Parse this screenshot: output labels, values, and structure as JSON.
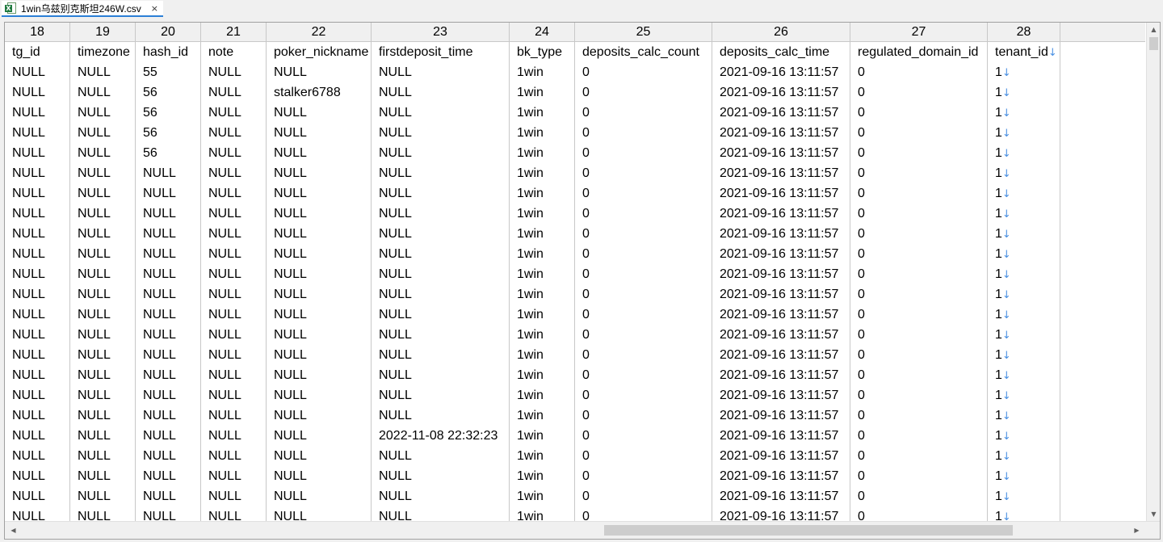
{
  "tab": {
    "title": "1win乌兹别克斯坦246W.csv",
    "close": "×",
    "icon": "excel-file-icon"
  },
  "columns": [
    {
      "number": "18",
      "name": "tg_id"
    },
    {
      "number": "19",
      "name": "timezone"
    },
    {
      "number": "20",
      "name": "hash_id"
    },
    {
      "number": "21",
      "name": "note"
    },
    {
      "number": "22",
      "name": "poker_nickname"
    },
    {
      "number": "23",
      "name": "firstdeposit_time"
    },
    {
      "number": "24",
      "name": "bk_type"
    },
    {
      "number": "25",
      "name": "deposits_calc_count"
    },
    {
      "number": "26",
      "name": "deposits_calc_time"
    },
    {
      "number": "27",
      "name": "regulated_domain_id"
    },
    {
      "number": "28",
      "name": "tenant_id"
    }
  ],
  "line_end_marker": "↓",
  "rows": [
    [
      "NULL",
      "NULL",
      "55",
      "NULL",
      "NULL",
      "NULL",
      "1win",
      "0",
      "2021-09-16 13:11:57",
      "0",
      "1"
    ],
    [
      "NULL",
      "NULL",
      "56",
      "NULL",
      "stalker6788",
      "NULL",
      "1win",
      "0",
      "2021-09-16 13:11:57",
      "0",
      "1"
    ],
    [
      "NULL",
      "NULL",
      "56",
      "NULL",
      "NULL",
      "NULL",
      "1win",
      "0",
      "2021-09-16 13:11:57",
      "0",
      "1"
    ],
    [
      "NULL",
      "NULL",
      "56",
      "NULL",
      "NULL",
      "NULL",
      "1win",
      "0",
      "2021-09-16 13:11:57",
      "0",
      "1"
    ],
    [
      "NULL",
      "NULL",
      "56",
      "NULL",
      "NULL",
      "NULL",
      "1win",
      "0",
      "2021-09-16 13:11:57",
      "0",
      "1"
    ],
    [
      "NULL",
      "NULL",
      "NULL",
      "NULL",
      "NULL",
      "NULL",
      "1win",
      "0",
      "2021-09-16 13:11:57",
      "0",
      "1"
    ],
    [
      "NULL",
      "NULL",
      "NULL",
      "NULL",
      "NULL",
      "NULL",
      "1win",
      "0",
      "2021-09-16 13:11:57",
      "0",
      "1"
    ],
    [
      "NULL",
      "NULL",
      "NULL",
      "NULL",
      "NULL",
      "NULL",
      "1win",
      "0",
      "2021-09-16 13:11:57",
      "0",
      "1"
    ],
    [
      "NULL",
      "NULL",
      "NULL",
      "NULL",
      "NULL",
      "NULL",
      "1win",
      "0",
      "2021-09-16 13:11:57",
      "0",
      "1"
    ],
    [
      "NULL",
      "NULL",
      "NULL",
      "NULL",
      "NULL",
      "NULL",
      "1win",
      "0",
      "2021-09-16 13:11:57",
      "0",
      "1"
    ],
    [
      "NULL",
      "NULL",
      "NULL",
      "NULL",
      "NULL",
      "NULL",
      "1win",
      "0",
      "2021-09-16 13:11:57",
      "0",
      "1"
    ],
    [
      "NULL",
      "NULL",
      "NULL",
      "NULL",
      "NULL",
      "NULL",
      "1win",
      "0",
      "2021-09-16 13:11:57",
      "0",
      "1"
    ],
    [
      "NULL",
      "NULL",
      "NULL",
      "NULL",
      "NULL",
      "NULL",
      "1win",
      "0",
      "2021-09-16 13:11:57",
      "0",
      "1"
    ],
    [
      "NULL",
      "NULL",
      "NULL",
      "NULL",
      "NULL",
      "NULL",
      "1win",
      "0",
      "2021-09-16 13:11:57",
      "0",
      "1"
    ],
    [
      "NULL",
      "NULL",
      "NULL",
      "NULL",
      "NULL",
      "NULL",
      "1win",
      "0",
      "2021-09-16 13:11:57",
      "0",
      "1"
    ],
    [
      "NULL",
      "NULL",
      "NULL",
      "NULL",
      "NULL",
      "NULL",
      "1win",
      "0",
      "2021-09-16 13:11:57",
      "0",
      "1"
    ],
    [
      "NULL",
      "NULL",
      "NULL",
      "NULL",
      "NULL",
      "NULL",
      "1win",
      "0",
      "2021-09-16 13:11:57",
      "0",
      "1"
    ],
    [
      "NULL",
      "NULL",
      "NULL",
      "NULL",
      "NULL",
      "NULL",
      "1win",
      "0",
      "2021-09-16 13:11:57",
      "0",
      "1"
    ],
    [
      "NULL",
      "NULL",
      "NULL",
      "NULL",
      "NULL",
      "2022-11-08 22:32:23",
      "1win",
      "0",
      "2021-09-16 13:11:57",
      "0",
      "1"
    ],
    [
      "NULL",
      "NULL",
      "NULL",
      "NULL",
      "NULL",
      "NULL",
      "1win",
      "0",
      "2021-09-16 13:11:57",
      "0",
      "1"
    ],
    [
      "NULL",
      "NULL",
      "NULL",
      "NULL",
      "NULL",
      "NULL",
      "1win",
      "0",
      "2021-09-16 13:11:57",
      "0",
      "1"
    ],
    [
      "NULL",
      "NULL",
      "NULL",
      "NULL",
      "NULL",
      "NULL",
      "1win",
      "0",
      "2021-09-16 13:11:57",
      "0",
      "1"
    ],
    [
      "NULL",
      "NULL",
      "NULL",
      "NULL",
      "NULL",
      "NULL",
      "1win",
      "0",
      "2021-09-16 13:11:57",
      "0",
      "1"
    ]
  ],
  "scrollbars": {
    "up": "▲",
    "down": "▼",
    "left": "◀",
    "right": "▶"
  }
}
